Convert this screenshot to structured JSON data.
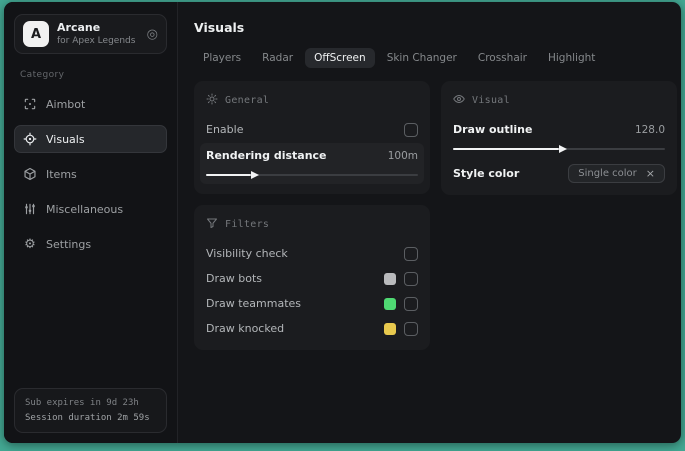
{
  "desktop": {
    "background": "#43a893"
  },
  "sidebar": {
    "brand": {
      "logo_letter": "A",
      "title": "Arcane",
      "subtitle": "for Apex Legends",
      "icon_glyph": "◎"
    },
    "category_label": "Category",
    "items": [
      {
        "label": "Aimbot",
        "icon": "crosshair-scan-icon",
        "selected": false
      },
      {
        "label": "Visuals",
        "icon": "focus-icon",
        "selected": true
      },
      {
        "label": "Items",
        "icon": "cube-icon",
        "selected": false
      },
      {
        "label": "Miscellaneous",
        "icon": "sliders-icon",
        "selected": false
      },
      {
        "label": "Settings",
        "icon": "gear-icon",
        "selected": false
      }
    ],
    "settings_gear_glyph": "⚙",
    "footer": {
      "sub_expires": "Sub expires in 9d 23h",
      "session_duration": "Session duration 2m 59s"
    }
  },
  "main": {
    "title": "Visuals",
    "tabs": [
      {
        "label": "Players",
        "selected": false
      },
      {
        "label": "Radar",
        "selected": false
      },
      {
        "label": "OffScreen",
        "selected": true
      },
      {
        "label": "Skin Changer",
        "selected": false
      },
      {
        "label": "Crosshair",
        "selected": false
      },
      {
        "label": "Highlight",
        "selected": false
      }
    ],
    "panels": {
      "general": {
        "title": "General",
        "icon": "sun-icon",
        "enable": {
          "label": "Enable",
          "checked": false
        },
        "rendering_distance": {
          "label": "Rendering distance",
          "value": "100m",
          "percent": 21
        }
      },
      "filters": {
        "title": "Filters",
        "icon": "funnel-icon",
        "rows": [
          {
            "label": "Visibility check",
            "checked": false
          },
          {
            "label": "Draw bots",
            "swatch": "#b9babc",
            "checked": false
          },
          {
            "label": "Draw teammates",
            "swatch": "#4fd973",
            "checked": false
          },
          {
            "label": "Draw knocked",
            "swatch": "#e8c94e",
            "checked": false
          }
        ]
      },
      "visual": {
        "title": "Visual",
        "icon": "eye-icon",
        "draw_outline": {
          "label": "Draw outline",
          "value": "128.0",
          "percent": 50
        },
        "style_color": {
          "label": "Style color",
          "selected_option": "Single color",
          "clear_glyph": "×"
        }
      }
    }
  },
  "colors": {
    "desktop_teal": "#43a893",
    "swatch_gray": "#b9babc",
    "swatch_green": "#4fd973",
    "swatch_yellow": "#e8c94e"
  }
}
